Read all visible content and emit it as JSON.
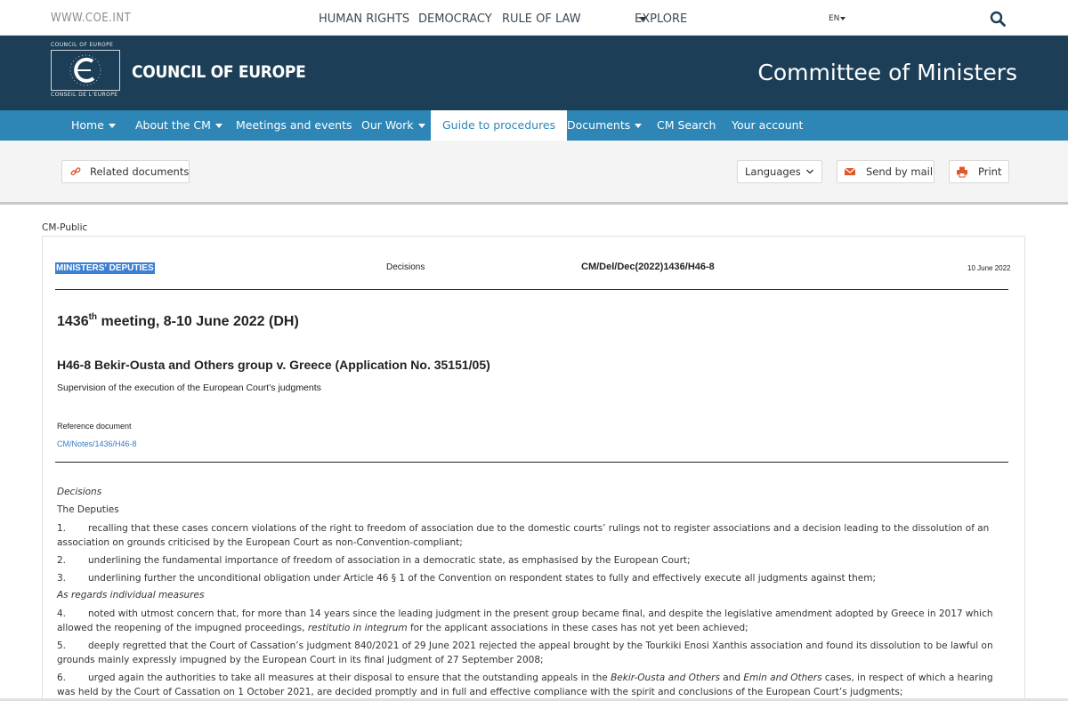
{
  "topbar": {
    "site": "WWW.COE.INT",
    "links": [
      "HUMAN RIGHTS",
      "DEMOCRACY",
      "RULE OF LAW"
    ],
    "explore": "EXPLORE",
    "lang": "EN"
  },
  "banner": {
    "logo_top": "COUNCIL OF EUROPE",
    "logo_bottom": "CONSEIL DE L'EUROPE",
    "brand": "COUNCIL OF EUROPE",
    "section_title": "Committee of Ministers"
  },
  "nav": {
    "home": "Home",
    "about": "About the CM",
    "meetings": "Meetings and events",
    "ourwork": "Our Work",
    "guide": "Guide to procedures",
    "documents": "Documents",
    "cmsearch": "CM Search",
    "account": "Your account"
  },
  "toolbar": {
    "related": "Related documents",
    "languages": "Languages",
    "sendmail": "Send by mail",
    "print": "Print"
  },
  "doc": {
    "classification": "CM-Public",
    "deputies": "MINISTERS' DEPUTIES",
    "decisions_label": "Decisions",
    "reference": "CM/Del/Dec(2022)1436/H46-8",
    "date": "10 June 2022",
    "meeting_num": "1436",
    "meeting_sup": "th",
    "meeting_rest": " meeting, 8-10 June 2022 (DH)",
    "case_title": "H46-8 Bekir-Ousta and Others group v. Greece (Application No. 35151/05)",
    "case_sub": "Supervision of the execution of the European Court’s judgments",
    "refdoc_label": "Reference document",
    "refdoc_link": "CM/Notes/1436/H46-8",
    "decisions_heading": "Decisions",
    "deputies_intro": "The Deputies",
    "p1_num": "1.",
    "p1": "recalling that these cases concern violations of the right to freedom of association due to the domestic courts’ rulings not to register associations and a decision leading to the dissolution of an association on grounds criticised by the European Court as non-Convention-compliant;",
    "p2_num": "2.",
    "p2": "underlining the fundamental importance of freedom of association in a democratic state, as emphasised by the European Court;",
    "p3_num": "3.",
    "p3": "underlining further the unconditional obligation under Article 46 § 1 of the Convention on respondent states to fully and effectively execute all judgments against them;",
    "individual_heading": "As regards individual measures",
    "p4_num": "4.",
    "p4a": "noted with utmost concern that, for more than 14 years since the leading judgment in the present group became final, and despite the legislative amendment adopted by Greece in 2017 which allowed the reopening of the impugned proceedings, ",
    "p4b": "restitutio in integrum",
    "p4c": " for the applicant associations in these cases has not yet been achieved;",
    "p5_num": "5.",
    "p5": "deeply regretted that the Court of Cassation’s judgment 840/2021 of 29 June 2021 rejected the appeal brought by the Tourkiki Enosi Xanthis association and found its dissolution to be lawful on grounds mainly expressly impugned by the European Court in its final judgment of 27 September 2008;",
    "p6_num": "6.",
    "p6a": "urged again the authorities to take all measures at their disposal to ensure that the outstanding appeals in the ",
    "p6b": "Bekir-Ousta and Others",
    "p6c": " and ",
    "p6d": "Emin and Others",
    "p6e": " cases, in respect of which a hearing was held by the Court of Cassation on 1 October 2021, are decided promptly and in full and effective compliance with the spirit and conclusions of the European Court’s judgments;"
  },
  "colors": {
    "banner": "#1c3e56",
    "nav": "#2d86b6",
    "link": "#3a7ac0",
    "print_icon": "#e0572a"
  }
}
